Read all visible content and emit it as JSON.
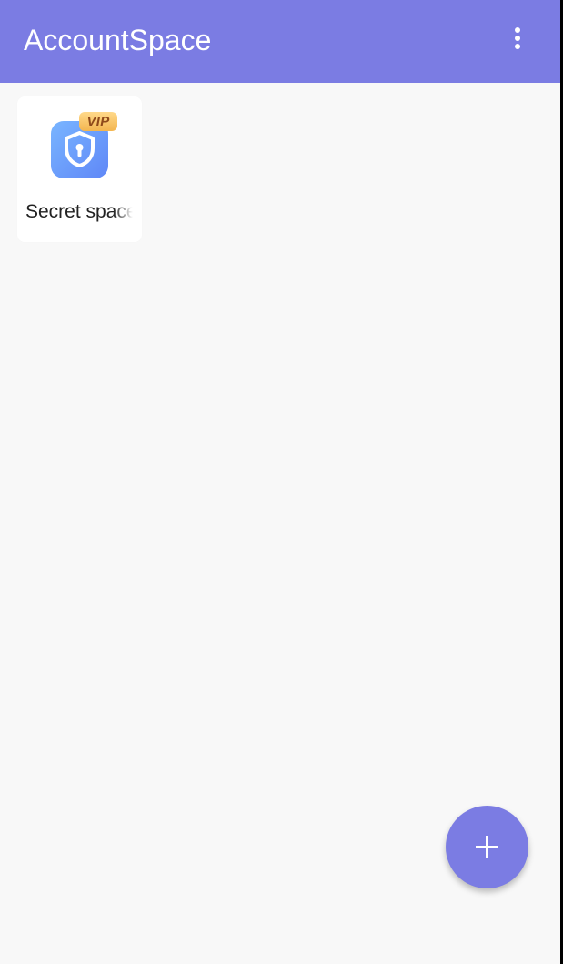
{
  "app_bar": {
    "title": "AccountSpace",
    "menu_icon": "more-vert-icon",
    "color": "#7b7ce3"
  },
  "apps": [
    {
      "label": "Secret space",
      "icon": "shield-lock-icon",
      "badge": "VIP"
    }
  ],
  "fab": {
    "icon": "plus-icon",
    "color": "#7b7ce3"
  }
}
